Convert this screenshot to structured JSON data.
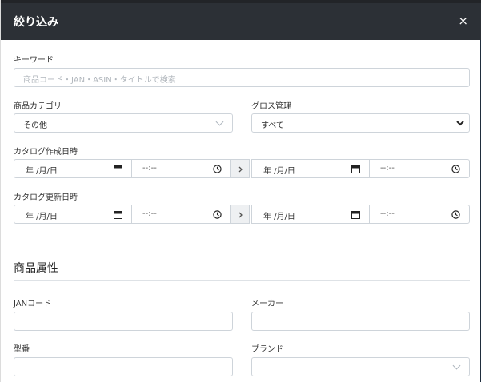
{
  "modal": {
    "title": "絞り込み",
    "close": "×"
  },
  "keyword": {
    "label": "キーワード",
    "placeholder": "商品コード・JAN・ASIN・タイトルで検索"
  },
  "category": {
    "label": "商品カテゴリ",
    "value": "その他"
  },
  "gross": {
    "label": "グロス管理",
    "value": "すべて"
  },
  "catalog_created": {
    "label": "カタログ作成日時",
    "from_date": "年 /月/日",
    "from_time": "--:--",
    "to_date": "年 /月/日",
    "to_time": "--:--"
  },
  "catalog_updated": {
    "label": "カタログ更新日時",
    "from_date": "年 /月/日",
    "from_time": "--:--",
    "to_date": "年 /月/日",
    "to_time": "--:--"
  },
  "attributes": {
    "section_title": "商品属性",
    "jan_label": "JANコード",
    "maker_label": "メーカー",
    "model_label": "型番",
    "brand_label": "ブランド"
  }
}
